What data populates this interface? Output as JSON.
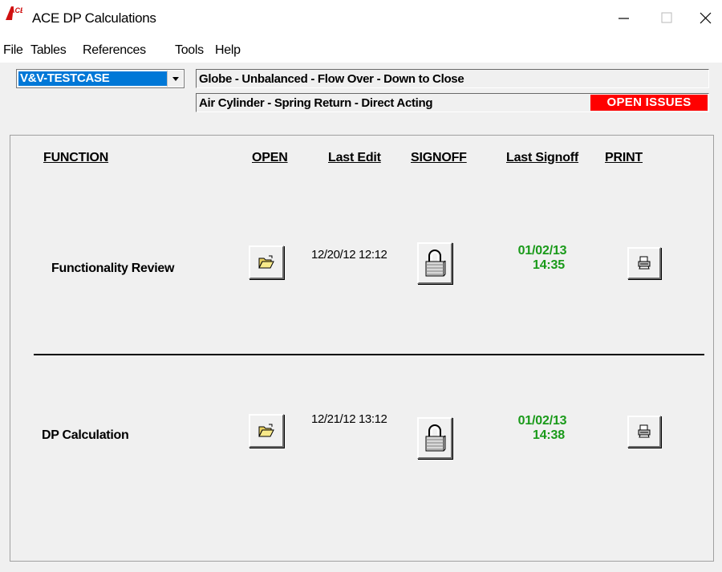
{
  "window": {
    "title": "ACE DP Calculations",
    "icon": "ace-logo-icon"
  },
  "menu": [
    "File",
    "Tables",
    "References",
    "Tools",
    "Help"
  ],
  "case_select": {
    "value": "V&V-TESTCASE"
  },
  "valve_info": {
    "line1": "Globe - Unbalanced - Flow Over - Down to Close",
    "line2": "Air Cylinder - Spring Return - Direct Acting",
    "status": "OPEN ISSUES",
    "status_color": "#ff0000"
  },
  "columns": {
    "function": "FUNCTION",
    "open": "OPEN",
    "last_edit": "Last Edit",
    "signoff": "SIGNOFF",
    "last_signoff": "Last Signoff",
    "print": "PRINT"
  },
  "rows": [
    {
      "function": "Functionality Review",
      "last_edit": "12/20/12 12:12",
      "last_signoff_date": "01/02/13",
      "last_signoff_time": "14:35"
    },
    {
      "function": "DP Calculation",
      "last_edit": "12/21/12 13:12",
      "last_signoff_date": "01/02/13",
      "last_signoff_time": "14:38"
    }
  ],
  "icons": {
    "open": "folder-open-icon",
    "signoff": "padlock-icon",
    "print": "printer-icon"
  },
  "colors": {
    "signoff_text": "#1a9a1a",
    "selection": "#0078d7"
  }
}
